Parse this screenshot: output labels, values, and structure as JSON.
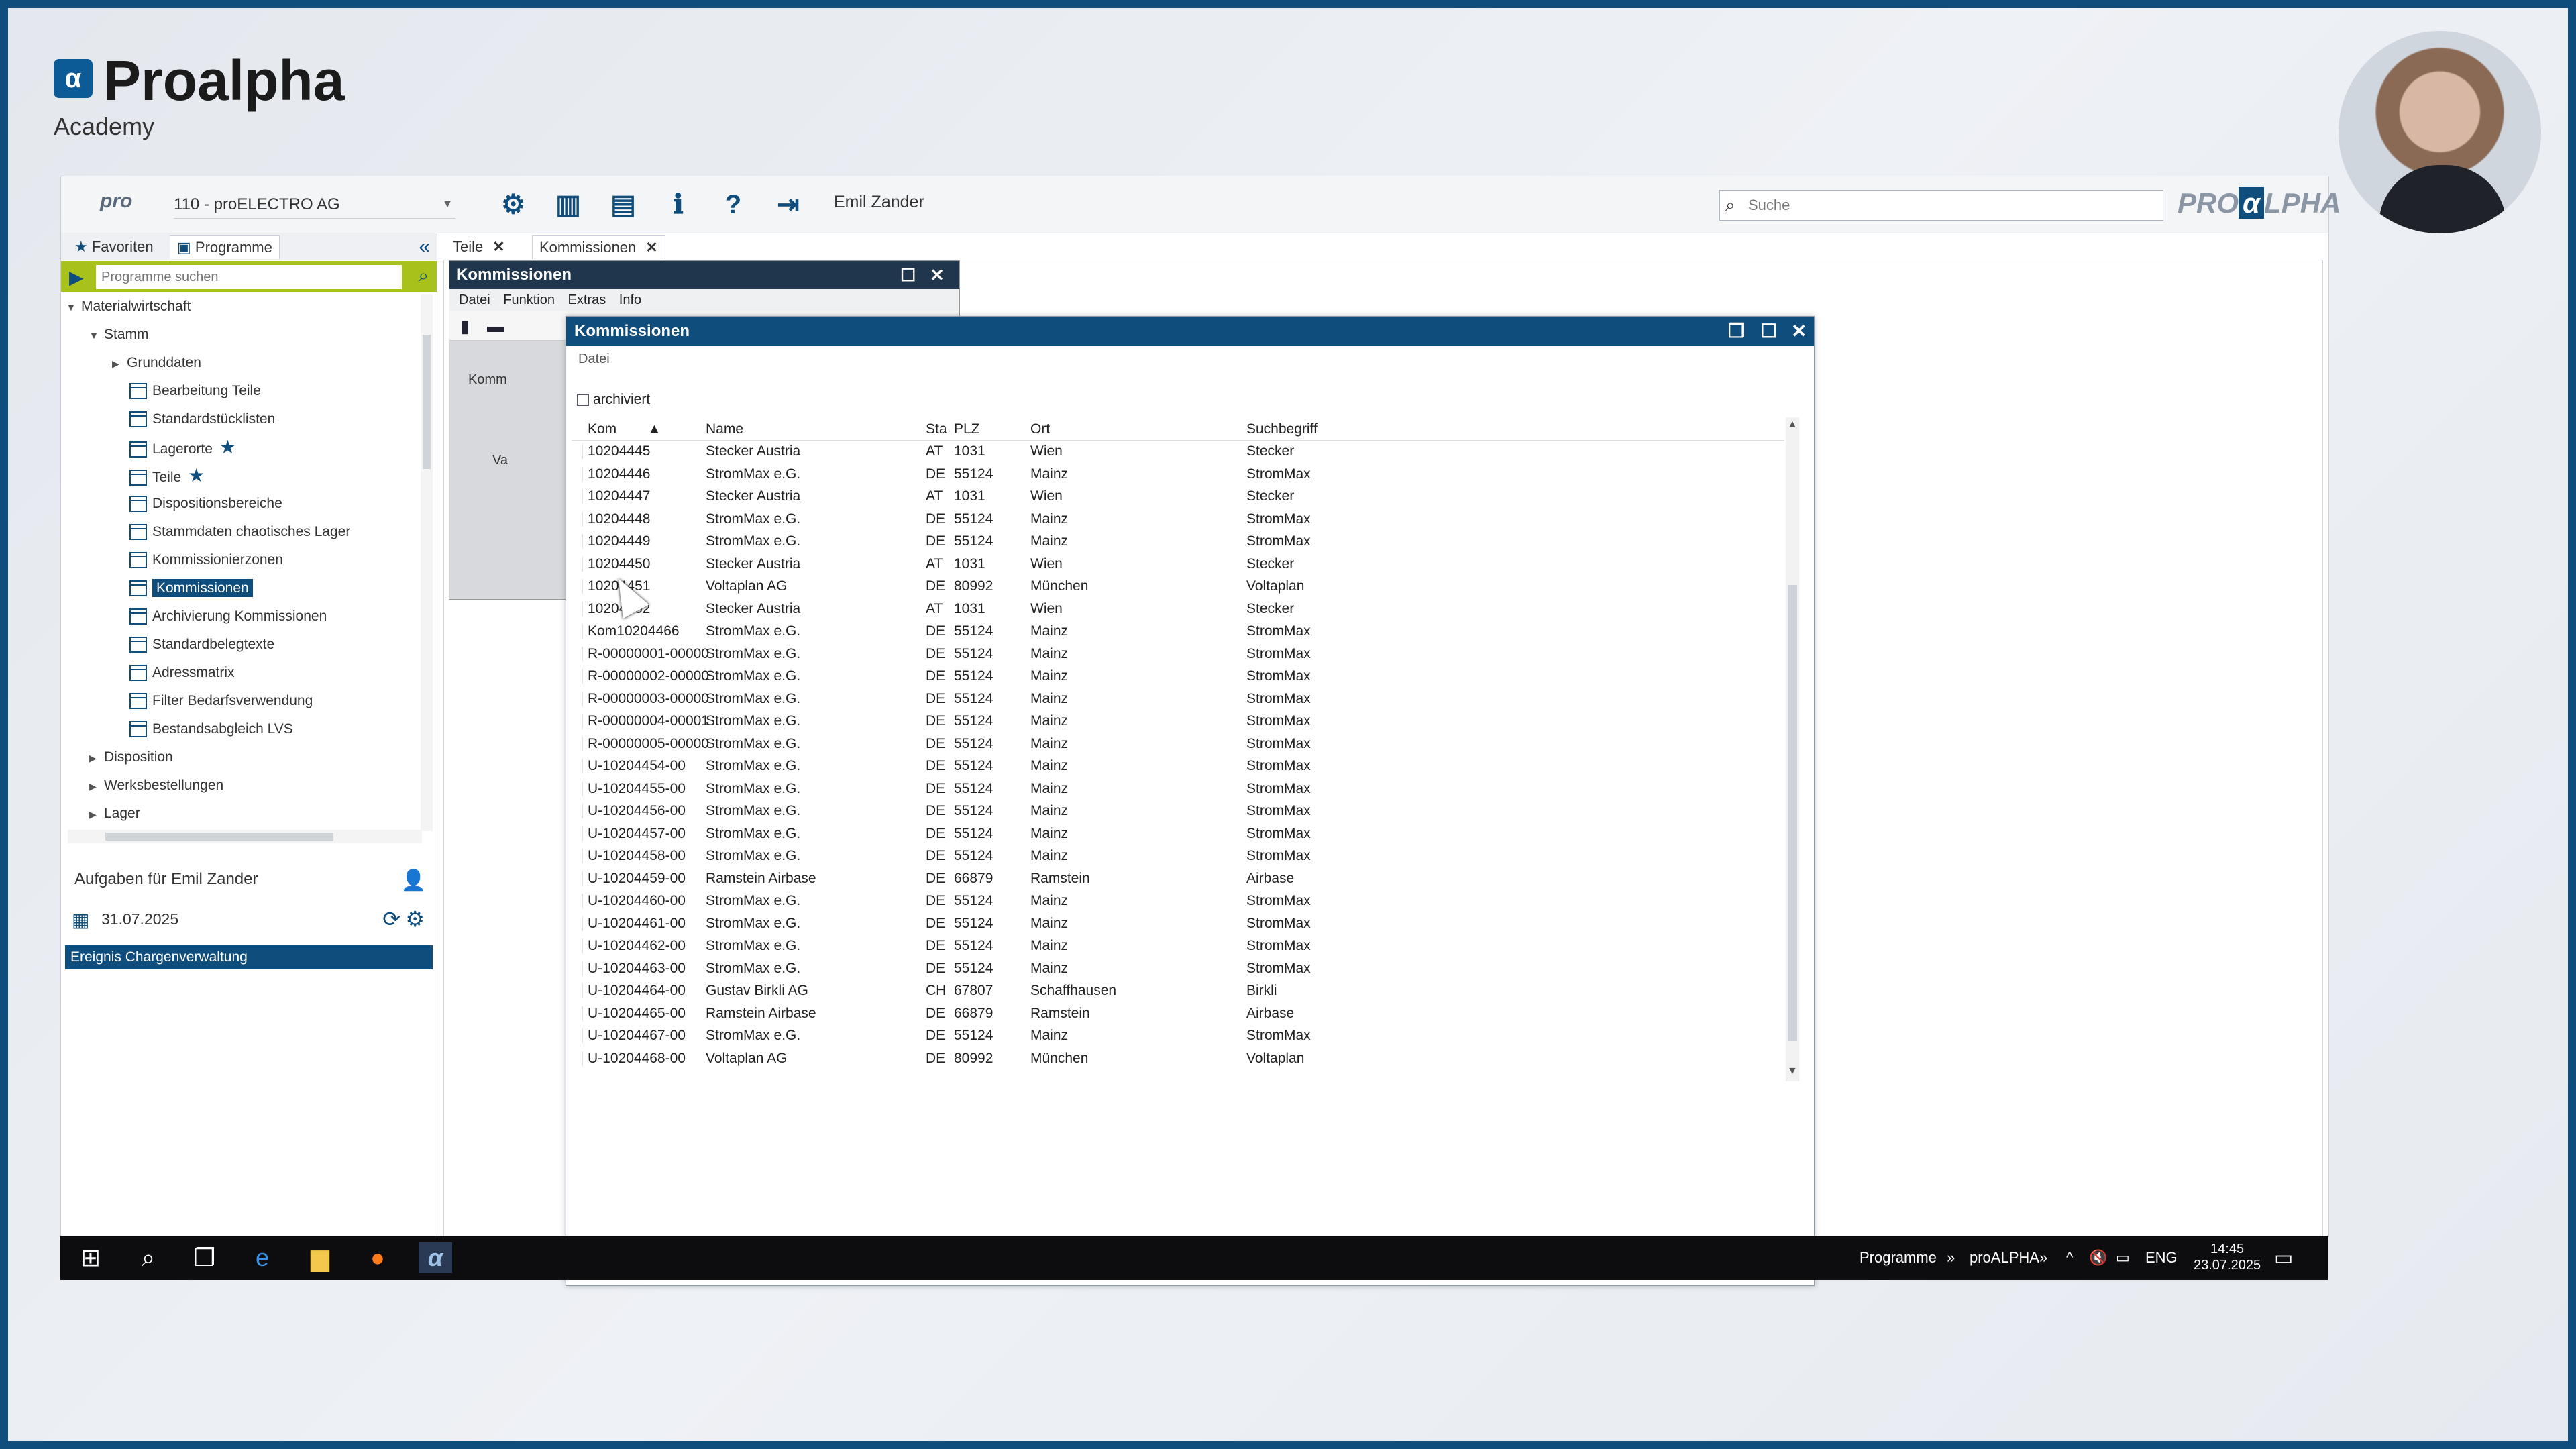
{
  "branding": {
    "logo_name": "Proalpha",
    "logo_sub": "Academy"
  },
  "toolbar": {
    "pro_logo": "pro",
    "company": "110 - proELECTRO AG",
    "user": "Emil Zander",
    "search_placeholder": "Suche",
    "brand_left": "PRO",
    "brand_alpha": "α",
    "brand_right": "LPHA"
  },
  "left_panel": {
    "tab_favoriten": "Favoriten",
    "tab_programme": "Programme",
    "search_placeholder": "Programme suchen",
    "tree": [
      "Materialwirtschaft",
      "Stamm",
      "Grunddaten",
      "Bearbeitung Teile",
      "Standardstücklisten",
      "Lagerorte",
      "Teile",
      "Dispositionsbereiche",
      "Stammdaten chaotisches Lager",
      "Kommissionierzonen",
      "Kommissionen",
      "Archivierung Kommissionen",
      "Standardbelegtexte",
      "Adressmatrix",
      "Filter Bedarfsverwendung",
      "Bestandsabgleich LVS",
      "Disposition",
      "Werksbestellungen",
      "Lager"
    ],
    "tasks_title": "Aufgaben für Emil Zander",
    "tasks_date": "31.07.2025",
    "task_item": "Ereignis Chargenverwaltung"
  },
  "main_tabs": {
    "teile": "Teile",
    "kommissionen": "Kommissionen"
  },
  "back_window": {
    "title": "Kommissionen",
    "menu": [
      "Datei",
      "Funktion",
      "Extras",
      "Info"
    ],
    "label1": "Komm",
    "label2": "Va"
  },
  "front_window": {
    "title": "Kommissionen",
    "menu_datei": "Datei",
    "archiviert": "archiviert",
    "columns": {
      "kom": "Kom",
      "name": "Name",
      "sta": "Sta",
      "plz": "PLZ",
      "ort": "Ort",
      "such": "Suchbegriff"
    },
    "rows": [
      [
        "10204445",
        "Stecker Austria",
        "AT",
        "1031",
        "Wien",
        "Stecker"
      ],
      [
        "10204446",
        "StromMax e.G.",
        "DE",
        "55124",
        "Mainz",
        "StromMax"
      ],
      [
        "10204447",
        "Stecker Austria",
        "AT",
        "1031",
        "Wien",
        "Stecker"
      ],
      [
        "10204448",
        "StromMax e.G.",
        "DE",
        "55124",
        "Mainz",
        "StromMax"
      ],
      [
        "10204449",
        "StromMax e.G.",
        "DE",
        "55124",
        "Mainz",
        "StromMax"
      ],
      [
        "10204450",
        "Stecker Austria",
        "AT",
        "1031",
        "Wien",
        "Stecker"
      ],
      [
        "10204451",
        "Voltaplan AG",
        "DE",
        "80992",
        "München",
        "Voltaplan"
      ],
      [
        "10204452",
        "Stecker Austria",
        "AT",
        "1031",
        "Wien",
        "Stecker"
      ],
      [
        "Kom10204466",
        "StromMax e.G.",
        "DE",
        "55124",
        "Mainz",
        "StromMax"
      ],
      [
        "R-00000001-00000",
        "StromMax e.G.",
        "DE",
        "55124",
        "Mainz",
        "StromMax"
      ],
      [
        "R-00000002-00000",
        "StromMax e.G.",
        "DE",
        "55124",
        "Mainz",
        "StromMax"
      ],
      [
        "R-00000003-00000",
        "StromMax e.G.",
        "DE",
        "55124",
        "Mainz",
        "StromMax"
      ],
      [
        "R-00000004-00001",
        "StromMax e.G.",
        "DE",
        "55124",
        "Mainz",
        "StromMax"
      ],
      [
        "R-00000005-00000",
        "StromMax e.G.",
        "DE",
        "55124",
        "Mainz",
        "StromMax"
      ],
      [
        "U-10204454-00",
        "StromMax e.G.",
        "DE",
        "55124",
        "Mainz",
        "StromMax"
      ],
      [
        "U-10204455-00",
        "StromMax e.G.",
        "DE",
        "55124",
        "Mainz",
        "StromMax"
      ],
      [
        "U-10204456-00",
        "StromMax e.G.",
        "DE",
        "55124",
        "Mainz",
        "StromMax"
      ],
      [
        "U-10204457-00",
        "StromMax e.G.",
        "DE",
        "55124",
        "Mainz",
        "StromMax"
      ],
      [
        "U-10204458-00",
        "StromMax e.G.",
        "DE",
        "55124",
        "Mainz",
        "StromMax"
      ],
      [
        "U-10204459-00",
        "Ramstein Airbase",
        "DE",
        "66879",
        "Ramstein",
        "Airbase"
      ],
      [
        "U-10204460-00",
        "StromMax e.G.",
        "DE",
        "55124",
        "Mainz",
        "StromMax"
      ],
      [
        "U-10204461-00",
        "StromMax e.G.",
        "DE",
        "55124",
        "Mainz",
        "StromMax"
      ],
      [
        "U-10204462-00",
        "StromMax e.G.",
        "DE",
        "55124",
        "Mainz",
        "StromMax"
      ],
      [
        "U-10204463-00",
        "StromMax e.G.",
        "DE",
        "55124",
        "Mainz",
        "StromMax"
      ],
      [
        "U-10204464-00",
        "Gustav Birkli AG",
        "CH",
        "67807",
        "Schaffhausen",
        "Birkli"
      ],
      [
        "U-10204465-00",
        "Ramstein Airbase",
        "DE",
        "66879",
        "Ramstein",
        "Airbase"
      ],
      [
        "U-10204467-00",
        "StromMax e.G.",
        "DE",
        "55124",
        "Mainz",
        "StromMax"
      ],
      [
        "U-10204468-00",
        "Voltaplan AG",
        "DE",
        "80992",
        "München",
        "Voltaplan"
      ]
    ]
  },
  "taskbar": {
    "programme": "Programme",
    "proalpha": "proALPHA",
    "lang": "ENG",
    "time": "14:45",
    "date": "23.07.2025"
  },
  "colors": {
    "brand_blue": "#0f4d7d",
    "search_green": "#a8c11b"
  },
  "icons": [
    "settings-icon",
    "layout-columns-icon",
    "layout-panels-icon",
    "info-icon",
    "help-icon",
    "logout-icon",
    "search-icon"
  ]
}
